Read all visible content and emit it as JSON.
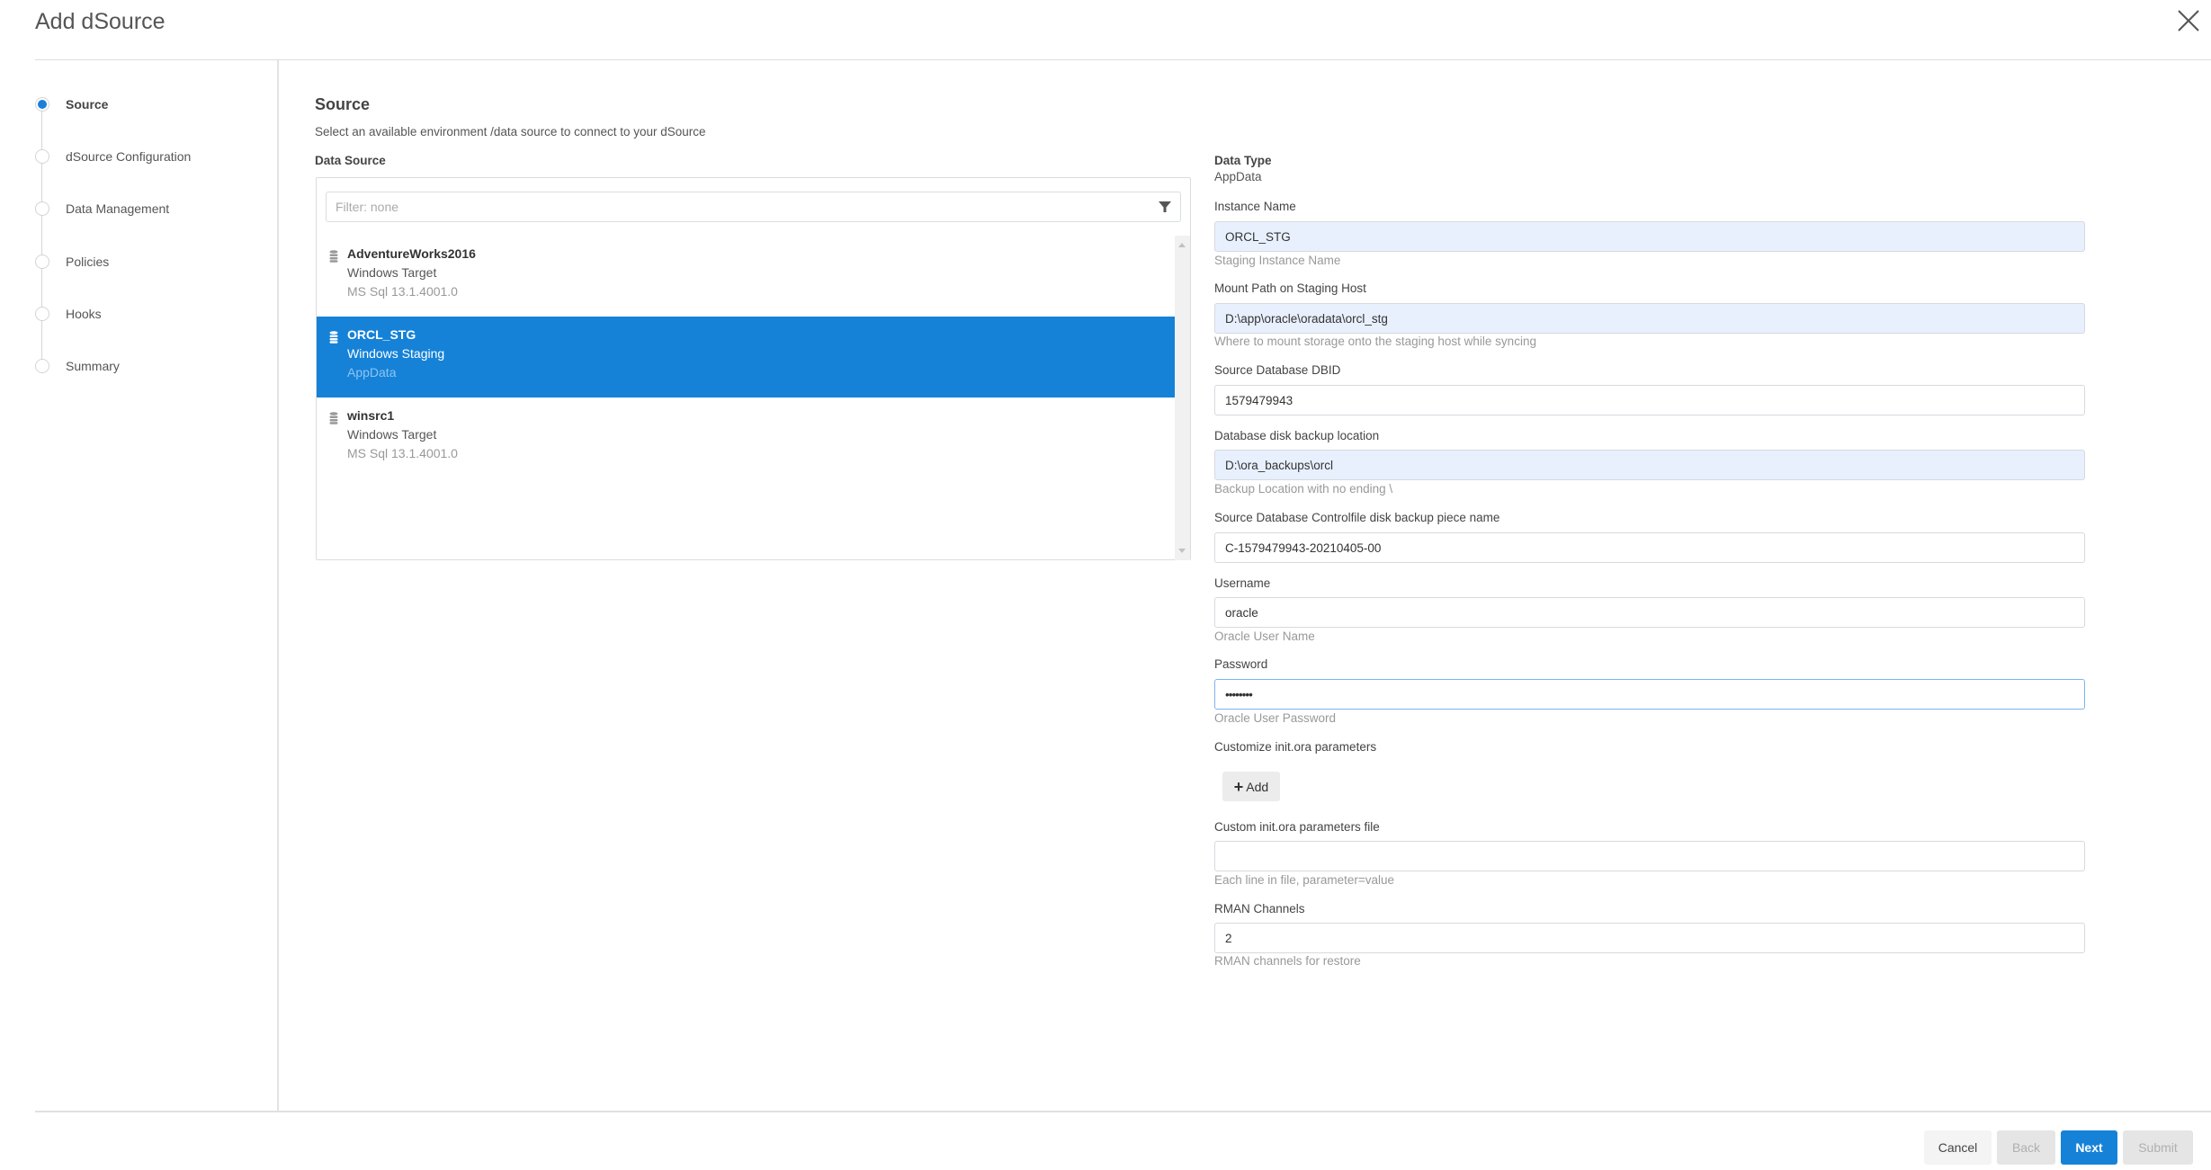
{
  "dialog": {
    "title": "Add dSource",
    "close_icon": "close-icon"
  },
  "stepper": {
    "steps": [
      {
        "label": "Source",
        "active": true
      },
      {
        "label": "dSource Configuration",
        "active": false
      },
      {
        "label": "Data Management",
        "active": false
      },
      {
        "label": "Policies",
        "active": false
      },
      {
        "label": "Hooks",
        "active": false
      },
      {
        "label": "Summary",
        "active": false
      }
    ]
  },
  "source": {
    "heading": "Source",
    "subtitle": "Select an available environment /data source to connect to your dSource",
    "data_source_label": "Data Source",
    "filter": {
      "placeholder": "Filter: none",
      "value": "",
      "icon": "filter-icon"
    },
    "items": [
      {
        "name": "AdventureWorks2016",
        "environment": "Windows Target",
        "type": "MS Sql 13.1.4001.0",
        "selected": false,
        "icon": "database-icon"
      },
      {
        "name": "ORCL_STG",
        "environment": "Windows Staging",
        "type": "AppData",
        "selected": true,
        "icon": "database-icon"
      },
      {
        "name": "winsrc1",
        "environment": "Windows Target",
        "type": "MS Sql 13.1.4001.0",
        "selected": false,
        "icon": "database-icon"
      }
    ]
  },
  "form": {
    "data_type_label": "Data Type",
    "data_type_value": "AppData",
    "instance_name": {
      "label": "Instance Name",
      "value": "ORCL_STG",
      "hint": "Staging Instance Name"
    },
    "mount_path": {
      "label": "Mount Path on Staging Host",
      "value": "D:\\app\\oracle\\oradata\\orcl_stg",
      "hint": "Where to mount storage onto the staging host while syncing"
    },
    "dbid": {
      "label": "Source Database DBID",
      "value": "1579479943"
    },
    "backup_location": {
      "label": "Database disk backup location",
      "value": "D:\\ora_backups\\orcl",
      "hint": "Backup Location with no ending \\"
    },
    "controlfile": {
      "label": "Source Database Controlfile disk backup piece name",
      "value": "C-1579479943-20210405-00"
    },
    "username": {
      "label": "Username",
      "value": "oracle",
      "hint": "Oracle User Name"
    },
    "password": {
      "label": "Password",
      "value": "••••••••",
      "hint": "Oracle User Password"
    },
    "init_params": {
      "label": "Customize init.ora parameters",
      "add_label": "Add"
    },
    "init_file": {
      "label": "Custom init.ora parameters file",
      "value": "",
      "hint": "Each line in file, parameter=value"
    },
    "rman": {
      "label": "RMAN Channels",
      "value": "2",
      "hint": "RMAN channels for restore"
    }
  },
  "footer": {
    "cancel": "Cancel",
    "back": "Back",
    "next": "Next",
    "submit": "Submit"
  },
  "colors": {
    "accent": "#1582d8",
    "selected_row": "#1582d8",
    "autofill_input": "#e8f0fe"
  }
}
